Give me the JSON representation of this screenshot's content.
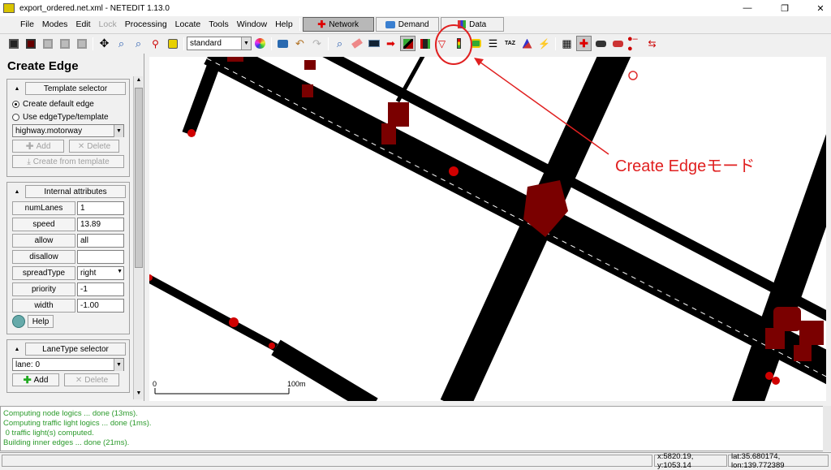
{
  "window": {
    "title": "export_ordered.net.xml - NETEDIT 1.13.0",
    "controls": [
      "—",
      "❐",
      "✕"
    ]
  },
  "menu": [
    "File",
    "Modes",
    "Edit",
    "Lock",
    "Processing",
    "Locate",
    "Tools",
    "Window",
    "Help"
  ],
  "supermodes": {
    "network": "Network",
    "demand": "Demand",
    "data": "Data"
  },
  "toolbar": {
    "scheme": "standard"
  },
  "panel": {
    "title": "Create Edge",
    "template_selector": {
      "header": "Template selector",
      "opt_default": "Create default edge",
      "opt_type": "Use edgeType/template",
      "type_value": "highway.motorway",
      "add": "Add",
      "delete": "Delete",
      "create_from_template": "Create from template"
    },
    "internal_attributes": {
      "header": "Internal attributes",
      "rows": [
        {
          "label": "numLanes",
          "value": "1"
        },
        {
          "label": "speed",
          "value": "13.89"
        },
        {
          "label": "allow",
          "value": "all"
        },
        {
          "label": "disallow",
          "value": ""
        },
        {
          "label": "spreadType",
          "value": "right"
        },
        {
          "label": "priority",
          "value": "-1"
        },
        {
          "label": "width",
          "value": "-1.00"
        }
      ],
      "help": "Help"
    },
    "lanetype_selector": {
      "header": "LaneType selector",
      "lane_value": "lane: 0",
      "add": "Add",
      "delete": "Delete"
    }
  },
  "view": {
    "annotation": "Create Edgeモード",
    "scale_start": "0",
    "scale_end": "100m"
  },
  "log": [
    "Computing node logics ... done (13ms).",
    "Computing traffic light logics ... done (1ms).",
    " 0 traffic light(s) computed.",
    "Building inner edges ... done (21ms)."
  ],
  "status": {
    "xy": "x:5820.19, y:1053.14",
    "latlon": "lat:35.680174, lon:139.772389"
  }
}
